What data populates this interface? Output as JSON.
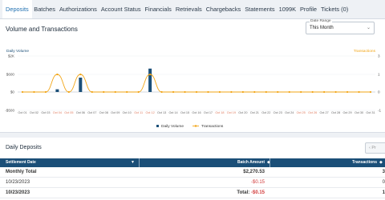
{
  "tabs": [
    {
      "label": "Deposits",
      "active": true
    },
    {
      "label": "Batches"
    },
    {
      "label": "Authorizations"
    },
    {
      "label": "Account Status"
    },
    {
      "label": "Financials"
    },
    {
      "label": "Retrievals"
    },
    {
      "label": "Chargebacks"
    },
    {
      "label": "Statements"
    },
    {
      "label": "1099K"
    },
    {
      "label": "Profile"
    },
    {
      "label": "Tickets (0)"
    }
  ],
  "chart_section": {
    "title": "Volume and Transactions",
    "date_range": {
      "legend": "Date Range",
      "value": "This Month"
    }
  },
  "chart_data": {
    "type": "bar",
    "ylabel_left": "Daily Volume",
    "ylabel_right": "Transactions",
    "left_ticks": [
      "$2K",
      "$600",
      "$0",
      "-$500"
    ],
    "right_ticks": [
      "3",
      "1",
      "0",
      "-1"
    ],
    "categories": [
      "Oct 01",
      "Oct 02",
      "Oct 03",
      "Oct 04",
      "Oct 05",
      "Oct 06",
      "Oct 07",
      "Oct 08",
      "Oct 09",
      "Oct 10",
      "Oct 11",
      "Oct 12",
      "Oct 13",
      "Oct 14",
      "Oct 15",
      "Oct 16",
      "Oct 17",
      "Oct 18",
      "Oct 19",
      "Oct 20",
      "Oct 21",
      "Oct 22",
      "Oct 23",
      "Oct 24",
      "Oct 25",
      "Oct 26",
      "Oct 27",
      "Oct 28",
      "Oct 29",
      "Oct 30",
      "Oct 31"
    ],
    "weekend_indices": [
      3,
      4,
      10,
      11,
      17,
      18,
      24,
      25
    ],
    "series": [
      {
        "name": "Daily Volume",
        "color": "#1b4f78",
        "values": [
          0,
          0,
          0,
          150,
          0,
          800,
          0,
          0,
          0,
          0,
          0,
          1300,
          0,
          0,
          0,
          0,
          0,
          0,
          0,
          0,
          0,
          0,
          0,
          0,
          0,
          0,
          0,
          0,
          0,
          0,
          0
        ]
      },
      {
        "name": "Transactions",
        "color": "#f2a516",
        "values": [
          0,
          0,
          0,
          1,
          0,
          1,
          0,
          0,
          0,
          0,
          0,
          1,
          0,
          0,
          0,
          0,
          0,
          0,
          0,
          0,
          0,
          0,
          0,
          0,
          0,
          0,
          0,
          0,
          0,
          0,
          0
        ]
      }
    ]
  },
  "daily_deposits": {
    "title": "Daily Deposits",
    "prev_label": "Pr",
    "columns": {
      "settlement_date": "Settlement Date",
      "batch_amount": "Batch Amount",
      "transactions": "Transactions"
    },
    "rows": [
      {
        "date": "Monthly Total",
        "amount": "$2,270.53",
        "tx": "3",
        "bold": true
      },
      {
        "date": "10/23/2023",
        "amount": "-$0.15",
        "tx": "0",
        "neg": true
      },
      {
        "date": "10/23/2023",
        "amount_label": "Total:",
        "amount": "-$0.15",
        "tx": "1",
        "bold": true,
        "neg": true
      }
    ]
  }
}
